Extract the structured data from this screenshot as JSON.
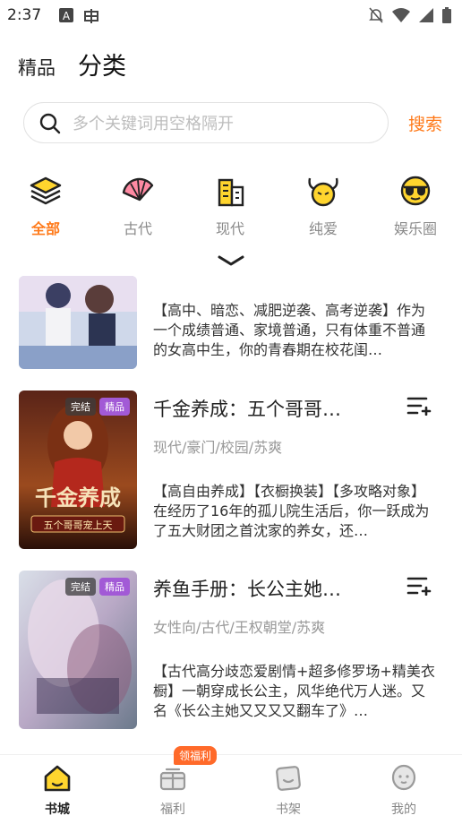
{
  "status": {
    "time": "2:37"
  },
  "topnav": {
    "tab_jingpin": "精品",
    "tab_fenlei": "分类"
  },
  "search": {
    "placeholder": "多个关键词用空格隔开",
    "button": "搜索"
  },
  "categories": [
    {
      "label": "全部",
      "icon": "layers-icon",
      "active": true
    },
    {
      "label": "古代",
      "icon": "folding-fan-icon",
      "active": false
    },
    {
      "label": "现代",
      "icon": "building-icon",
      "active": false
    },
    {
      "label": "纯爱",
      "icon": "horned-face-icon",
      "active": false
    },
    {
      "label": "娱乐圈",
      "icon": "sunglasses-face-icon",
      "active": false
    }
  ],
  "books": [
    {
      "title": "",
      "tags": "",
      "desc": "【高中、暗恋、减肥逆袭、高考逆袭】作为一个成绩普通、家境普通，只有体重不普通的女高中生，你的青春期在校花闺…",
      "badges": []
    },
    {
      "title": "千金养成：五个哥哥…",
      "tags": "现代/豪门/校园/苏爽",
      "desc": "【高自由养成】【衣橱换装】【多攻略对象】在经历了16年的孤儿院生活后，你一跃成为了五大财团之首沈家的养女，还…",
      "badges": [
        "完结",
        "精品"
      ],
      "cover_text": "千金养成",
      "cover_subtext": "五个哥哥宠上天"
    },
    {
      "title": "养鱼手册：长公主她…",
      "tags": "女性向/古代/王权朝堂/苏爽",
      "desc": "【古代高分歧恋爱剧情+超多修罗场+精美衣橱】一朝穿成长公主，风华绝代万人迷。又名《长公主她又又又又翻车了》…",
      "badges": [
        "完结",
        "精品"
      ]
    }
  ],
  "bottomnav": {
    "items": [
      {
        "label": "书城",
        "icon": "home-icon"
      },
      {
        "label": "福利",
        "icon": "gift-icon"
      },
      {
        "label": "书架",
        "icon": "bookshelf-icon"
      },
      {
        "label": "我的",
        "icon": "profile-icon"
      }
    ],
    "welfare_badge": "领福利"
  },
  "colors": {
    "accent": "#ff7a1a",
    "vip_badge": "#a25ad6"
  }
}
